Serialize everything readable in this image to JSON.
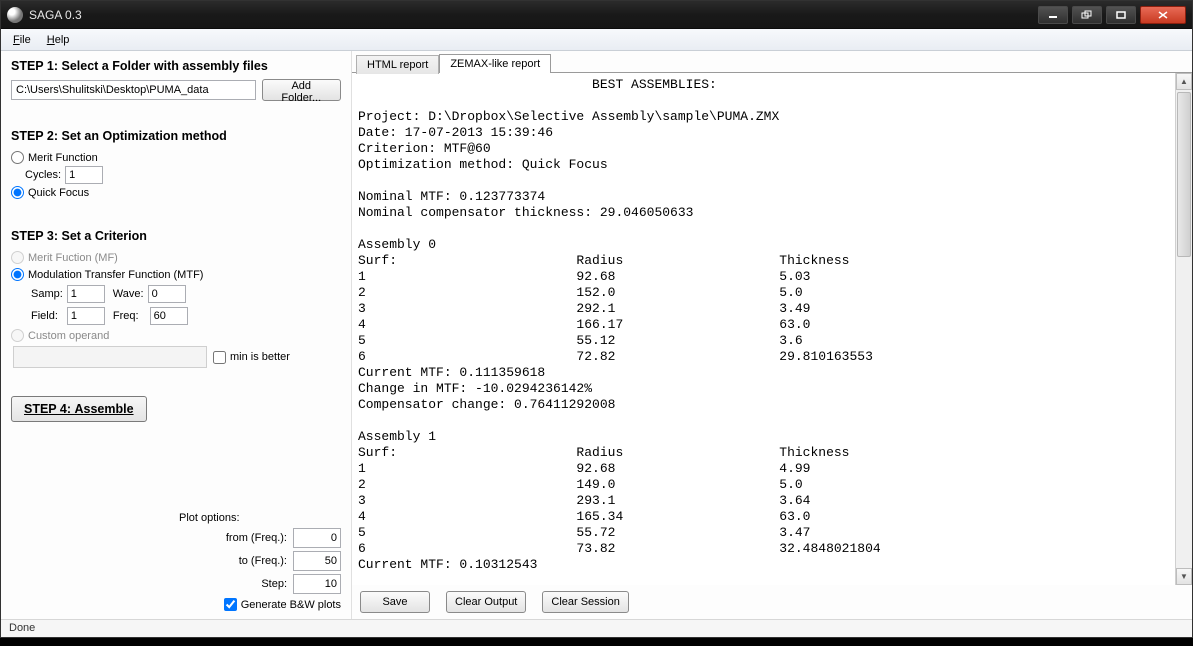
{
  "window": {
    "title": "SAGA 0.3"
  },
  "menu": {
    "file": "File",
    "help": "Help"
  },
  "steps": {
    "step1_title": "STEP 1: Select a Folder with assembly files",
    "folder_path": "C:\\Users\\Shulitski\\Desktop\\PUMA_data",
    "add_folder_btn": "Add Folder...",
    "step2_title": "STEP 2: Set an Optimization method",
    "merit_fn": "Merit Function",
    "cycles_label": "Cycles:",
    "cycles_value": "1",
    "quick_focus": "Quick Focus",
    "step3_title": "STEP 3: Set a Criterion",
    "merit_fuction_mf": "Merit Fuction (MF)",
    "mtf_label": "Modulation Transfer Function (MTF)",
    "samp_label": "Samp:",
    "samp_value": "1",
    "wave_label": "Wave:",
    "wave_value": "0",
    "field_label": "Field:",
    "field_value": "1",
    "freq_label": "Freq:",
    "freq_value": "60",
    "custom_op": "Custom operand",
    "min_is_better": "min is better",
    "step4_btn": "STEP 4: Assemble"
  },
  "plot": {
    "title": "Plot options:",
    "from_label": "from (Freq.):",
    "from_value": "0",
    "to_label": "to (Freq.):",
    "to_value": "50",
    "step_label": "Step:",
    "step_value": "10",
    "bw_label": "Generate B&W plots"
  },
  "tabs": {
    "html_report": "HTML report",
    "zemax_report": "ZEMAX-like report"
  },
  "buttons": {
    "save": "Save",
    "clear_output": "Clear Output",
    "clear_session": "Clear Session"
  },
  "status": "Done",
  "report_text": "                              BEST ASSEMBLIES:\n\nProject: D:\\Dropbox\\Selective Assembly\\sample\\PUMA.ZMX\nDate: 17-07-2013 15:39:46\nCriterion: MTF@60\nOptimization method: Quick Focus\n\nNominal MTF: 0.123773374\nNominal compensator thickness: 29.046050633\n\nAssembly 0\nSurf:                       Radius                    Thickness\n1                           92.68                     5.03\n2                           152.0                     5.0\n3                           292.1                     3.49\n4                           166.17                    63.0\n5                           55.12                     3.6\n6                           72.82                     29.810163553\nCurrent MTF: 0.111359618\nChange in MTF: -10.0294236142%\nCompensator change: 0.76411292008\n\nAssembly 1\nSurf:                       Radius                    Thickness\n1                           92.68                     4.99\n2                           149.0                     5.0\n3                           293.1                     3.64\n4                           165.34                    63.0\n5                           55.72                     3.47\n6                           73.82                     32.4848021804\nCurrent MTF: 0.10312543"
}
